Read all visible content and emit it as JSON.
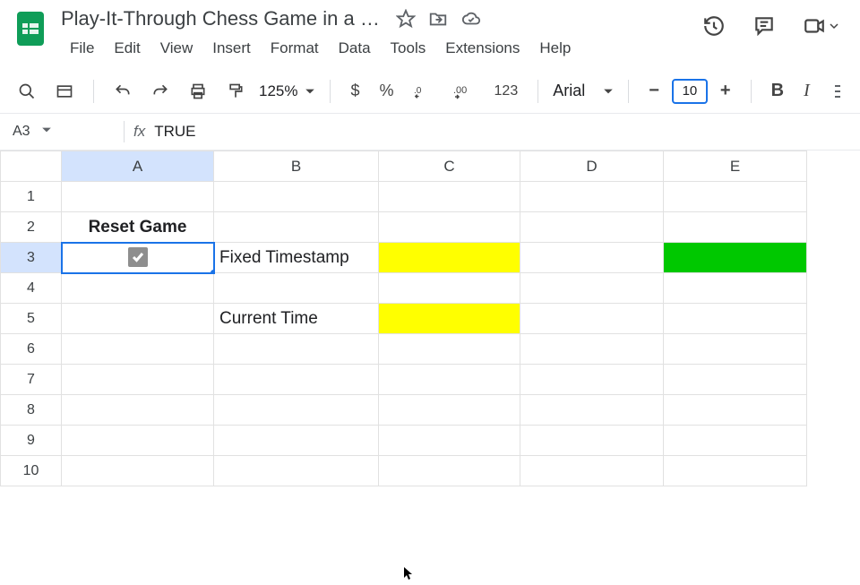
{
  "header": {
    "title": "Play-It-Through Chess Game in a Sin..."
  },
  "menu": {
    "file": "File",
    "edit": "Edit",
    "view": "View",
    "insert": "Insert",
    "format": "Format",
    "data": "Data",
    "tools": "Tools",
    "extensions": "Extensions",
    "help": "Help"
  },
  "toolbar": {
    "zoom": "125%",
    "currency": "$",
    "percent": "%",
    "num123": "123",
    "font": "Arial",
    "font_size": "10",
    "bold": "B",
    "italic": "I",
    "minus": "−",
    "plus": "+"
  },
  "formula_bar": {
    "cell_ref": "A3",
    "value": "TRUE"
  },
  "grid": {
    "columns": [
      "A",
      "B",
      "C",
      "D",
      "E"
    ],
    "row_numbers": [
      "1",
      "2",
      "3",
      "4",
      "5",
      "6",
      "7",
      "8",
      "9",
      "10"
    ],
    "active_col": "A",
    "active_row": "3",
    "cells": {
      "A2": "Reset Game",
      "A3_checked": true,
      "B3": "Fixed Timestamp",
      "B5": "Current Time"
    }
  }
}
